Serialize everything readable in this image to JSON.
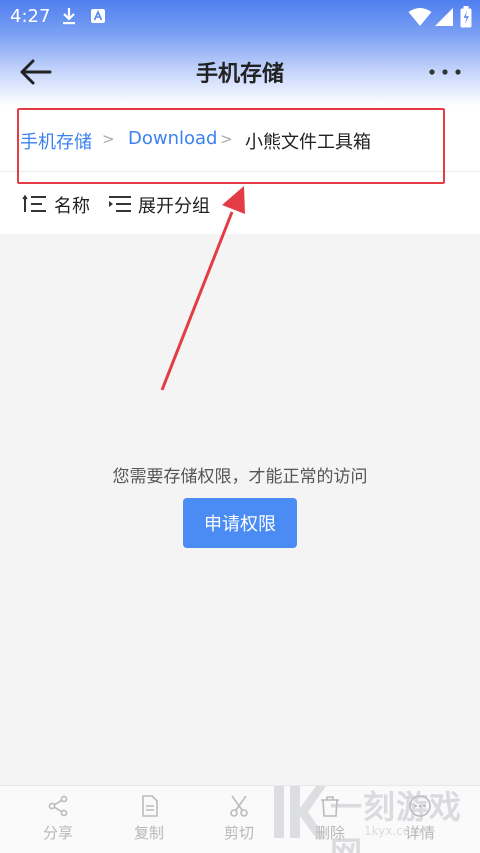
{
  "status_bar": {
    "time": "4:27"
  },
  "header": {
    "title": "手机存储"
  },
  "breadcrumb": {
    "items": [
      {
        "label": "手机存储"
      },
      {
        "label": "Download"
      },
      {
        "label": "小熊文件工具箱"
      }
    ],
    "separator": ">"
  },
  "sort_bar": {
    "name_label": "名称",
    "group_label": "展开分组"
  },
  "empty_state": {
    "message": "您需要存储权限，才能正常的访问",
    "button_label": "申请权限"
  },
  "bottom_bar": {
    "items": [
      {
        "label": "分享",
        "icon": "share-icon"
      },
      {
        "label": "复制",
        "icon": "copy-icon"
      },
      {
        "label": "剪切",
        "icon": "scissors-icon"
      },
      {
        "label": "删除",
        "icon": "trash-icon"
      },
      {
        "label": "详情",
        "icon": "more-circle-icon"
      }
    ]
  },
  "watermark": {
    "text": "一刻游戏网",
    "sub": "1kyx.com"
  },
  "colors": {
    "accent": "#4a8bf4",
    "link": "#3b82f0",
    "annotation": "#e43c45"
  }
}
